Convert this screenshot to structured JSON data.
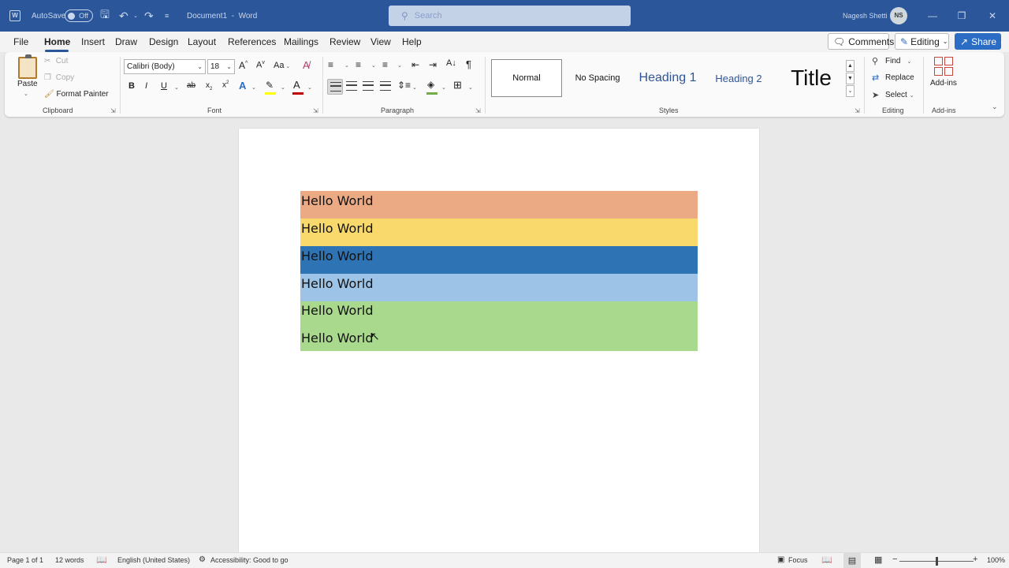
{
  "titlebar": {
    "autosave_label": "AutoSave",
    "autosave_state": "Off",
    "doc_title": "Document1",
    "separator": "-",
    "app_name": "Word",
    "search_placeholder": "Search",
    "user_name": "Nagesh Shetti",
    "user_initials": "NS"
  },
  "menu": {
    "items": [
      "File",
      "Home",
      "Insert",
      "Draw",
      "Design",
      "Layout",
      "References",
      "Mailings",
      "Review",
      "View",
      "Help"
    ],
    "active": "Home",
    "comments_label": "Comments",
    "editing_label": "Editing",
    "share_label": "Share"
  },
  "ribbon": {
    "clipboard": {
      "label": "Clipboard",
      "paste": "Paste",
      "cut": "Cut",
      "copy": "Copy",
      "format_painter": "Format Painter"
    },
    "font": {
      "label": "Font",
      "font_name": "Calibri (Body)",
      "font_size": "18",
      "font_color": "#c00000",
      "highlight_color": "#ffff00"
    },
    "paragraph": {
      "label": "Paragraph",
      "shading_color": "#70ad47"
    },
    "styles": {
      "label": "Styles",
      "items": [
        "Normal",
        "No Spacing",
        "Heading 1",
        "Heading 2",
        "Title"
      ]
    },
    "editing": {
      "label": "Editing",
      "find": "Find",
      "replace": "Replace",
      "select": "Select"
    },
    "addins": {
      "label": "Add-ins",
      "button": "Add-ins"
    }
  },
  "document": {
    "rows": [
      {
        "text": "Hello World",
        "color": "#eba984"
      },
      {
        "text": "Hello World",
        "color": "#f9d96b"
      },
      {
        "text": "Hello World",
        "color": "#2e74b5"
      },
      {
        "text": "Hello World",
        "color": "#9dc3e6"
      },
      {
        "text": "Hello World",
        "color": "#a9d98c"
      },
      {
        "text": "Hello World",
        "color": "#a9d98c"
      }
    ]
  },
  "status": {
    "page": "Page 1 of 1",
    "words": "12 words",
    "language": "English (United States)",
    "accessibility": "Accessibility: Good to go",
    "focus": "Focus",
    "zoom": "100%",
    "zoom_minus": "−",
    "zoom_plus": "+"
  }
}
